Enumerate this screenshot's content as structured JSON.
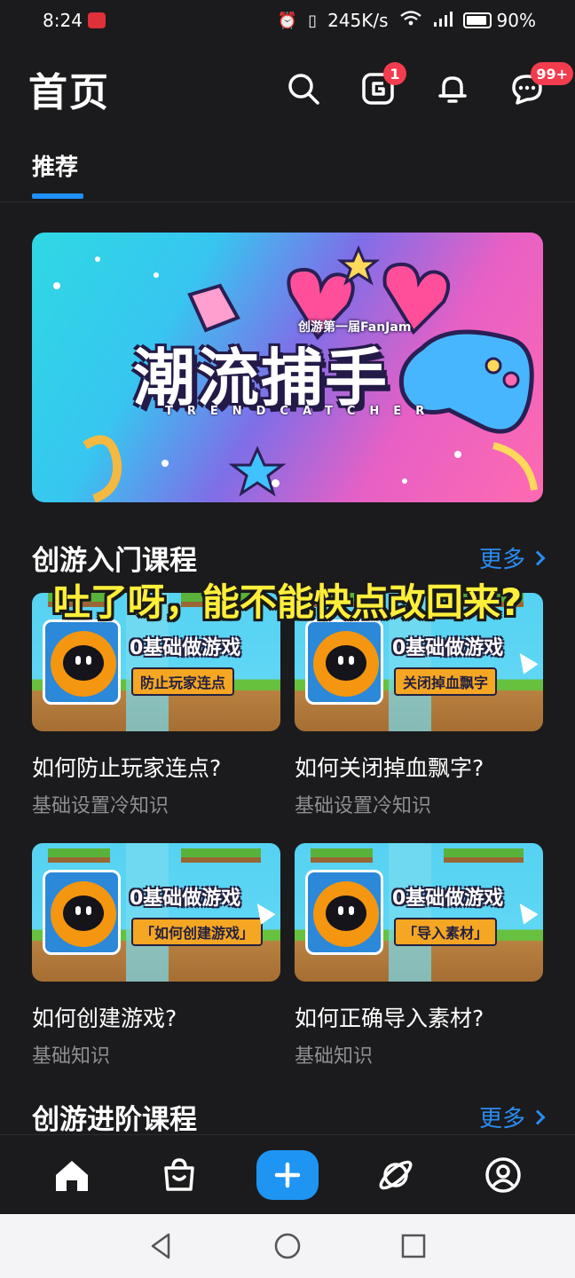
{
  "status_bar": {
    "time": "8:24",
    "speed": "245K/s",
    "battery": "90%"
  },
  "header": {
    "title": "首页",
    "notice_badge": "1",
    "message_badge": "99+"
  },
  "tabs": [
    {
      "label": "推荐"
    }
  ],
  "banner": {
    "subtitle": "创游第一届FanJam",
    "title": "潮流捕手",
    "caption": "TRENDCATCHER"
  },
  "sections": {
    "intro": {
      "title": "创游入门课程",
      "more": "更多"
    },
    "advanced": {
      "title": "创游进阶课程",
      "more": "更多"
    }
  },
  "courses": [
    {
      "series": "0基础做游戏",
      "topic": "防止玩家连点",
      "title": "如何防止玩家连点?",
      "subtitle": "基础设置冷知识"
    },
    {
      "series": "0基础做游戏",
      "topic": "关闭掉血飘字",
      "title": "如何关闭掉血飘字?",
      "subtitle": "基础设置冷知识"
    },
    {
      "series": "0基础做游戏",
      "topic": "「如何创建游戏」",
      "title": "如何创建游戏?",
      "subtitle": "基础知识"
    },
    {
      "series": "0基础做游戏",
      "topic": "「导入素材」",
      "title": "如何正确导入素材?",
      "subtitle": "基础知识"
    }
  ],
  "overlay": {
    "text": "吐了呀，能不能快点改回来?"
  },
  "colors": {
    "accent": "#1e94f3",
    "background": "#1b1b1d",
    "badge": "#f33c4d",
    "overlay_text": "#ffef3a"
  },
  "icons": {
    "search": "search-icon",
    "notice": "notice-icon",
    "bell": "bell-icon",
    "message": "message-icon",
    "home": "home-icon",
    "shop": "shop-icon",
    "create": "plus-icon",
    "discover": "planet-icon",
    "profile": "profile-icon"
  }
}
